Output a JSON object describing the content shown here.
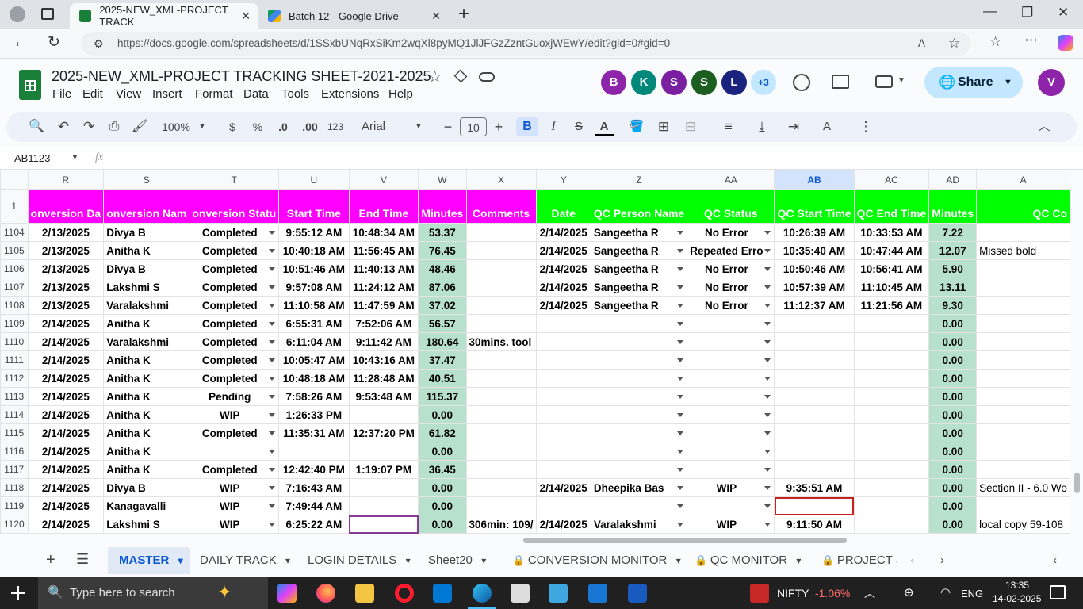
{
  "browser": {
    "tabs": [
      {
        "title": "2025-NEW_XML-PROJECT TRACK",
        "active": true
      },
      {
        "title": "Batch 12 - Google Drive",
        "active": false
      }
    ],
    "url": "https://docs.google.com/spreadsheets/d/1SSxbUNqRxSiKm2wqXl8pyMQ1JlJFGzZzntGuoxjWEwY/edit?gid=0#gid=0"
  },
  "app": {
    "title": "2025-NEW_XML-PROJECT TRACKING SHEET-2021-2025",
    "menu": [
      "File",
      "Edit",
      "View",
      "Insert",
      "Format",
      "Data",
      "Tools",
      "Extensions",
      "Help"
    ],
    "avatars": [
      {
        "letter": "B",
        "color": "#8e24aa"
      },
      {
        "letter": "K",
        "color": "#00897b"
      },
      {
        "letter": "S",
        "color": "#7b1fa2"
      },
      {
        "letter": "S",
        "color": "#1b5e20"
      },
      {
        "letter": "L",
        "color": "#1a237e"
      }
    ],
    "more_avatars": "+3",
    "share_label": "Share",
    "user_avatar": "V"
  },
  "toolbar": {
    "zoom": "100%",
    "currency": "$",
    "percent": "%",
    "dec_decrease": ".0",
    "dec_increase": ".00",
    "number_format": "123",
    "font": "Arial",
    "font_size": "10"
  },
  "formula_bar": {
    "name_box": "AB1123",
    "fx": "fx",
    "value": ""
  },
  "columns": [
    "R",
    "S",
    "T",
    "U",
    "V",
    "W",
    "X",
    "Y",
    "Z",
    "AA",
    "AB",
    "AC",
    "AD",
    "A"
  ],
  "selected_column": "AB",
  "header_row": {
    "row_number": "1",
    "cells": [
      "onversion Da",
      "onversion Nam",
      "onversion Statu",
      "Start Time",
      "End Time",
      "Minutes",
      "Comments",
      "Date",
      "QC Person Name",
      "QC Status",
      "QC Start Time",
      "QC End Time",
      "Minutes",
      "QC Co"
    ]
  },
  "rows": [
    {
      "n": "1104",
      "cells": [
        "2/13/2025",
        "Divya B",
        "Completed",
        "9:55:12 AM",
        "10:48:34 AM",
        "53.37",
        "",
        "2/14/2025",
        "Sangeetha R",
        "No Error",
        "10:26:39 AM",
        "10:33:53 AM",
        "7.22",
        ""
      ]
    },
    {
      "n": "1105",
      "cells": [
        "2/13/2025",
        "Anitha K",
        "Completed",
        "10:40:18 AM",
        "11:56:45 AM",
        "76.45",
        "",
        "2/14/2025",
        "Sangeetha R",
        "Repeated Erro",
        "10:35:40 AM",
        "10:47:44 AM",
        "12.07",
        "Missed bold"
      ]
    },
    {
      "n": "1106",
      "cells": [
        "2/13/2025",
        "Divya B",
        "Completed",
        "10:51:46 AM",
        "11:40:13 AM",
        "48.46",
        "",
        "2/14/2025",
        "Sangeetha R",
        "No Error",
        "10:50:46 AM",
        "10:56:41 AM",
        "5.90",
        ""
      ]
    },
    {
      "n": "1107",
      "cells": [
        "2/13/2025",
        "Lakshmi S",
        "Completed",
        "9:57:08 AM",
        "11:24:12 AM",
        "87.06",
        "",
        "2/14/2025",
        "Sangeetha R",
        "No Error",
        "10:57:39 AM",
        "11:10:45 AM",
        "13.11",
        ""
      ]
    },
    {
      "n": "1108",
      "cells": [
        "2/13/2025",
        "Varalakshmi",
        "Completed",
        "11:10:58 AM",
        "11:47:59 AM",
        "37.02",
        "",
        "2/14/2025",
        "Sangeetha R",
        "No Error",
        "11:12:37 AM",
        "11:21:56 AM",
        "9.30",
        ""
      ]
    },
    {
      "n": "1109",
      "cells": [
        "2/14/2025",
        "Anitha K",
        "Completed",
        "6:55:31 AM",
        "7:52:06 AM",
        "56.57",
        "",
        "",
        "",
        "",
        "",
        "",
        "0.00",
        ""
      ]
    },
    {
      "n": "1110",
      "cells": [
        "2/14/2025",
        "Varalakshmi",
        "Completed",
        "6:11:04 AM",
        "9:11:42 AM",
        "180.64",
        "30mins. tool",
        "",
        "",
        "",
        "",
        "",
        "0.00",
        ""
      ]
    },
    {
      "n": "1111",
      "cells": [
        "2/14/2025",
        "Anitha K",
        "Completed",
        "10:05:47 AM",
        "10:43:16 AM",
        "37.47",
        "",
        "",
        "",
        "",
        "",
        "",
        "0.00",
        ""
      ]
    },
    {
      "n": "1112",
      "cells": [
        "2/14/2025",
        "Anitha K",
        "Completed",
        "10:48:18 AM",
        "11:28:48 AM",
        "40.51",
        "",
        "",
        "",
        "",
        "",
        "",
        "0.00",
        ""
      ]
    },
    {
      "n": "1113",
      "cells": [
        "2/14/2025",
        "Anitha K",
        "Pending",
        "7:58:26 AM",
        "9:53:48 AM",
        "115.37",
        "",
        "",
        "",
        "",
        "",
        "",
        "0.00",
        ""
      ]
    },
    {
      "n": "1114",
      "cells": [
        "2/14/2025",
        "Anitha K",
        "WIP",
        "1:26:33 PM",
        "",
        "0.00",
        "",
        "",
        "",
        "",
        "",
        "",
        "0.00",
        ""
      ]
    },
    {
      "n": "1115",
      "cells": [
        "2/14/2025",
        "Anitha K",
        "Completed",
        "11:35:31 AM",
        "12:37:20 PM",
        "61.82",
        "",
        "",
        "",
        "",
        "",
        "",
        "0.00",
        ""
      ]
    },
    {
      "n": "1116",
      "cells": [
        "2/14/2025",
        "Anitha K",
        "",
        "",
        "",
        "0.00",
        "",
        "",
        "",
        "",
        "",
        "",
        "0.00",
        ""
      ]
    },
    {
      "n": "1117",
      "cells": [
        "2/14/2025",
        "Anitha K",
        "Completed",
        "12:42:40 PM",
        "1:19:07 PM",
        "36.45",
        "",
        "",
        "",
        "",
        "",
        "",
        "0.00",
        ""
      ]
    },
    {
      "n": "1118",
      "cells": [
        "2/14/2025",
        "Divya B",
        "WIP",
        "7:16:43 AM",
        "",
        "0.00",
        "",
        "2/14/2025",
        "Dheepika Bas",
        "WIP",
        "9:35:51 AM",
        "",
        "0.00",
        "Section II - 6.0 Wo"
      ]
    },
    {
      "n": "1119",
      "cells": [
        "2/14/2025",
        "Kanagavalli",
        "WIP",
        "7:49:44 AM",
        "",
        "0.00",
        "",
        "",
        "",
        "",
        "",
        "",
        "0.00",
        ""
      ]
    },
    {
      "n": "1120",
      "cells": [
        "2/14/2025",
        "Lakshmi S",
        "WIP",
        "6:25:22 AM",
        "",
        "0.00",
        "306min: 109/",
        "2/14/2025",
        "Varalakshmi",
        "WIP",
        "9:11:50 AM",
        "",
        "0.00",
        "local copy 59-108"
      ]
    }
  ],
  "sheet_tabs": [
    {
      "label": "MASTER",
      "active": true,
      "locked": false
    },
    {
      "label": "DAILY TRACK",
      "active": false,
      "locked": false
    },
    {
      "label": "LOGIN DETAILS",
      "active": false,
      "locked": false
    },
    {
      "label": "Sheet20",
      "active": false,
      "locked": false
    },
    {
      "label": "CONVERSION MONITOR",
      "active": false,
      "locked": true
    },
    {
      "label": "QC MONITOR",
      "active": false,
      "locked": true
    },
    {
      "label": "PROJECT S",
      "active": false,
      "locked": true
    }
  ],
  "taskbar": {
    "search_placeholder": "Type here to search",
    "stock_name": "NIFTY",
    "stock_change": "-1.06%",
    "language": "ENG",
    "time": "13:35",
    "date": "14-02-2025"
  }
}
